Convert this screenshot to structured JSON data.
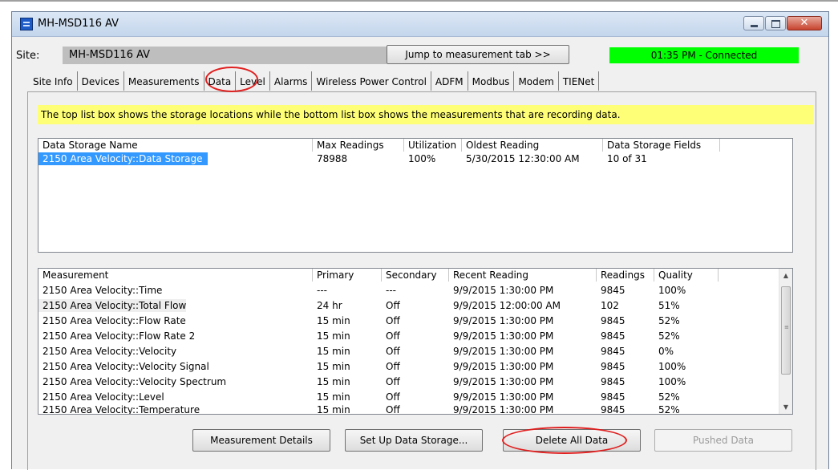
{
  "window": {
    "title": "MH-MSD116 AV",
    "controls": {
      "minimize": "",
      "maximize": "",
      "close": "✕"
    }
  },
  "site": {
    "label": "Site:",
    "value": "MH-MSD116 AV"
  },
  "jump_button": {
    "label": "Jump to measurement tab >>"
  },
  "status": {
    "text": "01:35 PM - Connected",
    "color": "#00ff00"
  },
  "tabs": [
    {
      "label": "Site Info"
    },
    {
      "label": "Devices"
    },
    {
      "label": "Measurements"
    },
    {
      "label": "Data",
      "active": true
    },
    {
      "label": "Level"
    },
    {
      "label": "Alarms"
    },
    {
      "label": "Wireless Power Control"
    },
    {
      "label": "ADFM"
    },
    {
      "label": "Modbus"
    },
    {
      "label": "Modem"
    },
    {
      "label": "TIENet"
    }
  ],
  "info_text": "The top list box shows the storage locations while the bottom list box shows the measurements that are recording data.",
  "storage_list": {
    "columns": [
      "Data Storage Name",
      "Max Readings",
      "Utilization",
      "Oldest Reading",
      "Data Storage Fields"
    ],
    "rows": [
      [
        "2150 Area Velocity::Data Storage",
        "78988",
        "100%",
        "5/30/2015 12:30:00 AM",
        "10 of 31"
      ]
    ]
  },
  "measurement_list": {
    "columns": [
      "Measurement",
      "Primary",
      "Secondary",
      "Recent Reading",
      "Readings",
      "Quality"
    ],
    "rows": [
      [
        "2150 Area Velocity::Time",
        "---",
        "---",
        "9/9/2015 1:30:00 PM",
        "9845",
        "100%"
      ],
      [
        "2150 Area Velocity::Total Flow",
        "24 hr",
        "Off",
        "9/9/2015 12:00:00 AM",
        "102",
        "51%"
      ],
      [
        "2150 Area Velocity::Flow Rate",
        "15 min",
        "Off",
        "9/9/2015 1:30:00 PM",
        "9845",
        "52%"
      ],
      [
        "2150 Area Velocity::Flow Rate 2",
        "15 min",
        "Off",
        "9/9/2015 1:30:00 PM",
        "9845",
        "52%"
      ],
      [
        "2150 Area Velocity::Velocity",
        "15 min",
        "Off",
        "9/9/2015 1:30:00 PM",
        "9845",
        "0%"
      ],
      [
        "2150 Area Velocity::Velocity Signal",
        "15 min",
        "Off",
        "9/9/2015 1:30:00 PM",
        "9845",
        "100%"
      ],
      [
        "2150 Area Velocity::Velocity Spectrum",
        "15 min",
        "Off",
        "9/9/2015 1:30:00 PM",
        "9845",
        "100%"
      ],
      [
        "2150 Area Velocity::Level",
        "15 min",
        "Off",
        "9/9/2015 1:30:00 PM",
        "9845",
        "52%"
      ],
      [
        "2150 Area Velocity::Temperature",
        "15 min",
        "Off",
        "9/9/2015 1:30:00 PM",
        "9845",
        "52%"
      ]
    ]
  },
  "scrollbar": {
    "up_icon": "▲",
    "down_icon": "▼",
    "grip": "≡"
  },
  "buttons": {
    "measurement_details": "Measurement Details",
    "set_up_storage": "Set Up Data Storage...",
    "delete_all": "Delete All Data",
    "pushed_data": "Pushed Data"
  },
  "colors": {
    "info_bar": "#ffff77",
    "selection": "#3399ff",
    "annotation_circle": "#e02020"
  }
}
